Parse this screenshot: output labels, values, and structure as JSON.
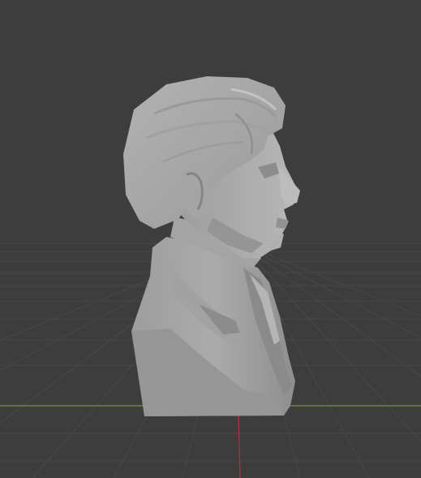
{
  "viewport": {
    "background_color": "#3d3d3d",
    "grid_color": "#4a4a4a",
    "x_axis_color": "#7fae3c",
    "y_axis_color": "#b53a44",
    "model": {
      "name": "bust-sculpture",
      "color": "#a9a9a9"
    }
  }
}
